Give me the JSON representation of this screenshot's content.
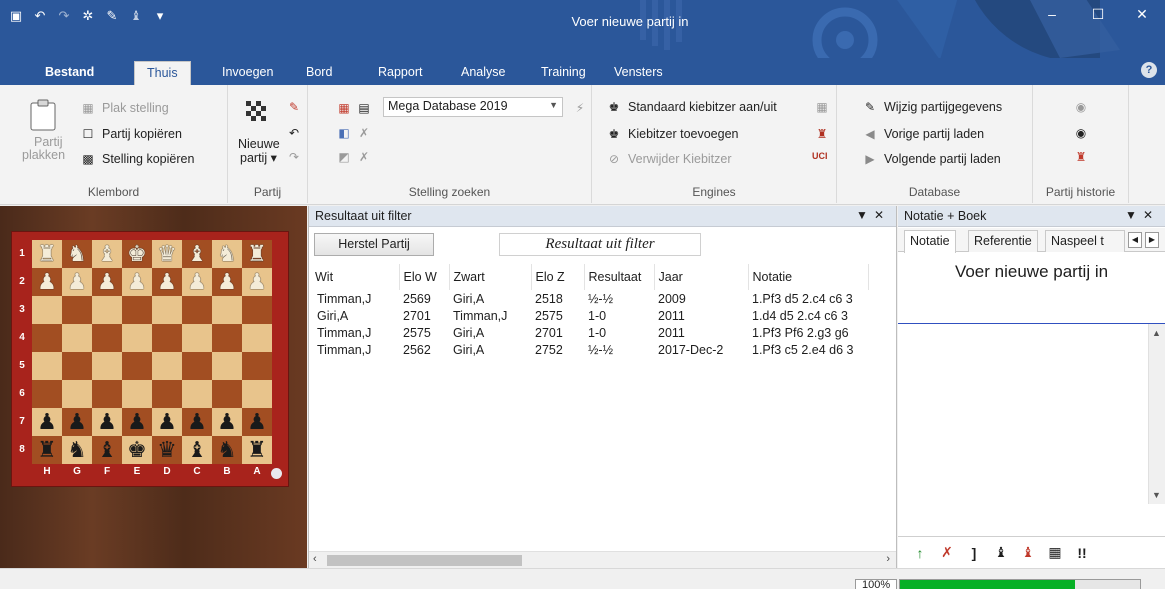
{
  "window": {
    "title": "Voer nieuwe partij in",
    "qat_icons": [
      "save-icon",
      "undo-icon",
      "redo-icon",
      "settings-cog-icon",
      "tools-icon",
      "engine-icon",
      "customize-qat-icon"
    ],
    "controls": [
      "–",
      "☐",
      "✕"
    ]
  },
  "tabs": [
    "Bestand",
    "Thuis",
    "Invoegen",
    "Bord",
    "Rapport",
    "Analyse",
    "Training",
    "Vensters"
  ],
  "ribbon": {
    "klembord": {
      "paste_label_1": "Partij",
      "paste_label_2": "plakken",
      "items": [
        "Plak stelling",
        "Partij kopiëren",
        "Stelling kopiëren"
      ],
      "label": "Klembord"
    },
    "partij": {
      "new_label_1": "Nieuwe",
      "new_label_2": "partij ▾",
      "label": "Partij"
    },
    "stelling_zoeken": {
      "database": "Mega Database 2019",
      "label": "Stelling zoeken"
    },
    "engines": {
      "items": [
        "Standaard kiebitzer aan/uit",
        "Kiebitzer toevoegen",
        "Verwijder Kiebitzer"
      ],
      "uci": "UCI",
      "label": "Engines"
    },
    "database": {
      "items": [
        "Wijzig partijgegevens",
        "Vorige partij laden",
        "Volgende partij laden"
      ],
      "label": "Database"
    },
    "historie": {
      "label": "Partij historie"
    }
  },
  "board": {
    "ranks": [
      "1",
      "2",
      "3",
      "4",
      "5",
      "6",
      "7",
      "8"
    ],
    "files": [
      "H",
      "G",
      "F",
      "E",
      "D",
      "C",
      "B",
      "A"
    ],
    "rows": [
      [
        "wR",
        "wN",
        "wB",
        "wK",
        "wQ",
        "wB",
        "wN",
        "wR"
      ],
      [
        "wP",
        "wP",
        "wP",
        "wP",
        "wP",
        "wP",
        "wP",
        "wP"
      ],
      [
        "",
        "",
        "",
        "",
        "",
        "",
        "",
        ""
      ],
      [
        "",
        "",
        "",
        "",
        "",
        "",
        "",
        ""
      ],
      [
        "",
        "",
        "",
        "",
        "",
        "",
        "",
        ""
      ],
      [
        "",
        "",
        "",
        "",
        "",
        "",
        "",
        ""
      ],
      [
        "bP",
        "bP",
        "bP",
        "bP",
        "bP",
        "bP",
        "bP",
        "bP"
      ],
      [
        "bR",
        "bN",
        "bB",
        "bK",
        "bQ",
        "bB",
        "bN",
        "bR"
      ]
    ]
  },
  "center": {
    "header": "Resultaat uit filter",
    "restore_button": "Herstel Partij",
    "filter_title": "Resultaat uit filter",
    "columns": [
      "Wit",
      "Elo W",
      "Zwart",
      "Elo Z",
      "Resultaat",
      "Jaar",
      "Notatie"
    ],
    "rows": [
      [
        "Timman,J",
        "2569",
        "Giri,A",
        "2518",
        "½-½",
        "2009",
        "1.Pf3 d5 2.c4 c6 3"
      ],
      [
        "Giri,A",
        "2701",
        "Timman,J",
        "2575",
        "1-0",
        "2011",
        "1.d4 d5 2.c4 c6 3"
      ],
      [
        "Timman,J",
        "2575",
        "Giri,A",
        "2701",
        "1-0",
        "2011",
        "1.Pf3 Pf6 2.g3 g6"
      ],
      [
        "Timman,J",
        "2562",
        "Giri,A",
        "2752",
        "½-½",
        "2017-Dec-2",
        "1.Pf3 c5 2.e4 d6 3"
      ]
    ]
  },
  "right": {
    "header": "Notatie + Boek",
    "tabs": [
      "Notatie",
      "Referentie",
      "Naspeel t"
    ],
    "title": "Voer nieuwe partij in"
  },
  "status": {
    "zoom": "100%",
    "progress": 0.73
  },
  "colors": {
    "accent": "#2b579a",
    "board_light": "#e8c48c",
    "board_dark": "#a24e22",
    "board_frame": "#a8231c"
  }
}
